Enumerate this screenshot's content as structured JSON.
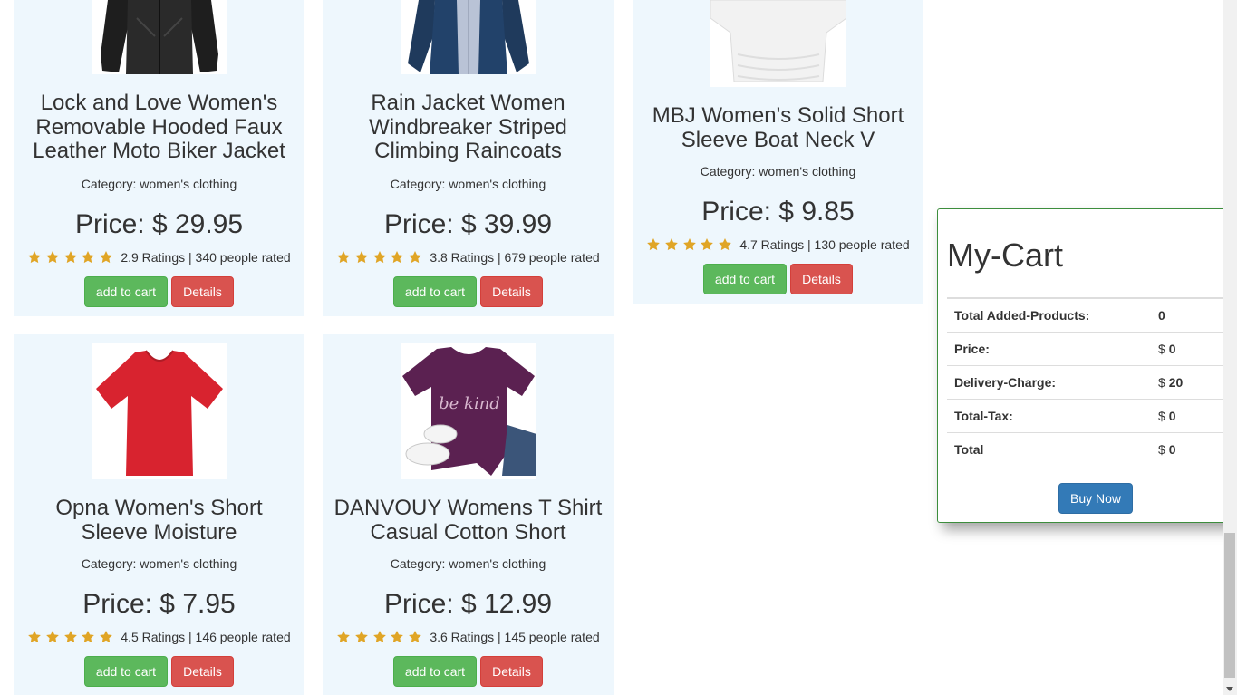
{
  "products": [
    {
      "title": "Lock and Love Women's Removable Hooded Faux Leather Moto Biker Jacket",
      "category": "Category: women's clothing",
      "price": "Price: $ 29.95",
      "rating_text": "2.9 Ratings | 340 people rated",
      "add_label": "add to cart",
      "details_label": "Details",
      "image": "black-leather-jacket"
    },
    {
      "title": "Rain Jacket Women Windbreaker Striped Climbing Raincoats",
      "category": "Category: women's clothing",
      "price": "Price: $ 39.99",
      "rating_text": "3.8 Ratings | 679 people rated",
      "add_label": "add to cart",
      "details_label": "Details",
      "image": "navy-rain-jacket"
    },
    {
      "title": "MBJ Women's Solid Short Sleeve Boat Neck V",
      "category": "Category: women's clothing",
      "price": "Price: $ 9.85",
      "rating_text": "4.7 Ratings | 130 people rated",
      "add_label": "add to cart",
      "details_label": "Details",
      "image": "white-top"
    },
    {
      "title": "Opna Women's Short Sleeve Moisture",
      "category": "Category: women's clothing",
      "price": "Price: $ 7.95",
      "rating_text": "4.5 Ratings | 146 people rated",
      "add_label": "add to cart",
      "details_label": "Details",
      "image": "red-tshirt"
    },
    {
      "title": "DANVOUY Womens T Shirt Casual Cotton Short",
      "category": "Category: women's clothing",
      "price": "Price: $ 12.99",
      "rating_text": "3.6 Ratings | 145 people rated",
      "add_label": "add to cart",
      "details_label": "Details",
      "image": "purple-be-kind-tshirt",
      "image_text": "be kind"
    }
  ],
  "star_color": "#e0a526",
  "cart": {
    "title": "My-Cart",
    "rows": [
      {
        "label": "Total Added-Products:",
        "prefix": "",
        "value": "0"
      },
      {
        "label": "Price:",
        "prefix": "$",
        "value": "0"
      },
      {
        "label": "Delivery-Charge:",
        "prefix": "$",
        "value": "20"
      },
      {
        "label": "Total-Tax:",
        "prefix": "$",
        "value": "0"
      },
      {
        "label": "Total",
        "prefix": "$",
        "value": "0"
      }
    ],
    "buy_label": "Buy Now"
  }
}
